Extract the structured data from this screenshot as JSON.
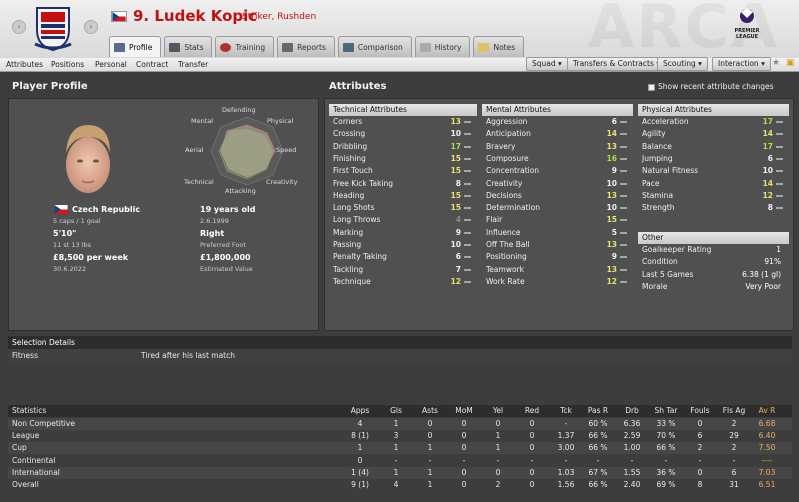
{
  "header": {
    "player_name": "9. Ludek Kopic",
    "player_subtitle": "Striker, Rushden",
    "bg_text": "ARCA",
    "tabs": [
      {
        "label": "Profile",
        "icon": "profile-icon"
      },
      {
        "label": "Stats",
        "icon": "stats-icon"
      },
      {
        "label": "Training",
        "icon": "training-icon"
      },
      {
        "label": "Reports",
        "icon": "reports-icon"
      },
      {
        "label": "Comparison",
        "icon": "comparison-icon"
      },
      {
        "label": "History",
        "icon": "history-icon"
      },
      {
        "label": "Notes",
        "icon": "notes-icon"
      }
    ],
    "league_logo_text": "PREMIER LEAGUE"
  },
  "subnav": {
    "items": [
      "Attributes",
      "Positions",
      "Personal",
      "Contract",
      "Transfer"
    ],
    "dropdowns": [
      "Squad",
      "Transfers & Contracts",
      "Scouting",
      "Interaction"
    ]
  },
  "profile": {
    "title": "Player Profile",
    "radar_labels": {
      "defending": "Defending",
      "mental": "Mental",
      "physical": "Physical",
      "aerial": "Aerial",
      "speed": "Speed",
      "technical": "Technical",
      "creativity": "Creativity",
      "attacking": "Attacking"
    },
    "nation": "Czech Republic",
    "caps": "5 caps / 1 goal",
    "age": "19 years old",
    "dob": "2.6.1999",
    "height": "5'10\"",
    "weight": "11 st 13 lbs",
    "foot": "Right",
    "foot_label": "Preferred Foot",
    "wage": "£8,500 per week",
    "contract_end": "30.6.2022",
    "value": "£1,800,000",
    "value_label": "Estimated Value"
  },
  "attributes": {
    "title": "Attributes",
    "show_changes_label": "Show recent attribute changes",
    "technical_header": "Technical Attributes",
    "mental_header": "Mental Attributes",
    "physical_header": "Physical Attributes",
    "other_header": "Other",
    "technical": [
      [
        "Corners",
        "13"
      ],
      [
        "Crossing",
        "10"
      ],
      [
        "Dribbling",
        "17"
      ],
      [
        "Finishing",
        "15"
      ],
      [
        "First Touch",
        "15"
      ],
      [
        "Free Kick Taking",
        "8"
      ],
      [
        "Heading",
        "15"
      ],
      [
        "Long Shots",
        "15"
      ],
      [
        "Long Throws",
        "4"
      ],
      [
        "Marking",
        "9"
      ],
      [
        "Passing",
        "10"
      ],
      [
        "Penalty Taking",
        "6"
      ],
      [
        "Tackling",
        "7"
      ],
      [
        "Technique",
        "12"
      ]
    ],
    "mental": [
      [
        "Aggression",
        "6"
      ],
      [
        "Anticipation",
        "14"
      ],
      [
        "Bravery",
        "13"
      ],
      [
        "Composure",
        "16"
      ],
      [
        "Concentration",
        "9"
      ],
      [
        "Creativity",
        "10"
      ],
      [
        "Decisions",
        "13"
      ],
      [
        "Determination",
        "10"
      ],
      [
        "Flair",
        "15"
      ],
      [
        "Influence",
        "5"
      ],
      [
        "Off The Ball",
        "13"
      ],
      [
        "Positioning",
        "9"
      ],
      [
        "Teamwork",
        "13"
      ],
      [
        "Work Rate",
        "12"
      ]
    ],
    "physical": [
      [
        "Acceleration",
        "17"
      ],
      [
        "Agility",
        "14"
      ],
      [
        "Balance",
        "17"
      ],
      [
        "Jumping",
        "6"
      ],
      [
        "Natural Fitness",
        "10"
      ],
      [
        "Pace",
        "14"
      ],
      [
        "Stamina",
        "12"
      ],
      [
        "Strength",
        "8"
      ]
    ],
    "other": [
      [
        "Goalkeeper Rating",
        "1"
      ],
      [
        "Condition",
        "91%"
      ],
      [
        "Last 5 Games",
        "6.38 (1 gl)"
      ],
      [
        "Morale",
        "Very Poor"
      ]
    ]
  },
  "selection": {
    "title": "Selection Details",
    "fitness_label": "Fitness",
    "fitness_value": "Tired after his last match"
  },
  "stats": {
    "title": "Statistics",
    "columns": [
      "Apps",
      "Gls",
      "Asts",
      "MoM",
      "Yel",
      "Red",
      "Tck",
      "Pas R",
      "Drb",
      "Sh Tar",
      "Fouls",
      "Fls Ag",
      "Av R"
    ],
    "rows": [
      {
        "label": "Non Competitive",
        "values": [
          "4",
          "1",
          "0",
          "0",
          "0",
          "0",
          "-",
          "60 %",
          "6.36",
          "33 %",
          "0",
          "2",
          "6.68"
        ]
      },
      {
        "label": "League",
        "values": [
          "8 (1)",
          "3",
          "0",
          "0",
          "1",
          "0",
          "1.37",
          "66 %",
          "2.59",
          "70 %",
          "6",
          "29",
          "6.40"
        ]
      },
      {
        "label": "Cup",
        "values": [
          "1",
          "1",
          "1",
          "0",
          "1",
          "0",
          "3.00",
          "66 %",
          "1.00",
          "66 %",
          "2",
          "2",
          "7.50"
        ]
      },
      {
        "label": "Continental",
        "values": [
          "0",
          "-",
          "-",
          "-",
          "-",
          "-",
          "-",
          "-",
          "-",
          "-",
          "-",
          "-",
          "----"
        ]
      },
      {
        "label": "International",
        "values": [
          "1 (4)",
          "1",
          "1",
          "0",
          "0",
          "0",
          "1.03",
          "67 %",
          "1.55",
          "36 %",
          "0",
          "6",
          "7.03"
        ]
      },
      {
        "label": "Overall",
        "values": [
          "9 (1)",
          "4",
          "1",
          "0",
          "2",
          "0",
          "1.56",
          "66 %",
          "2.40",
          "69 %",
          "8",
          "31",
          "6.51"
        ]
      }
    ]
  },
  "colors": {
    "name_red": "#c01010",
    "attr_high": "#a8e04a",
    "attr_mid": "#e8e070",
    "attr_low": "#f0f0f0",
    "attr_vlow": "#8a8a8a",
    "avr": "#e8b060"
  }
}
